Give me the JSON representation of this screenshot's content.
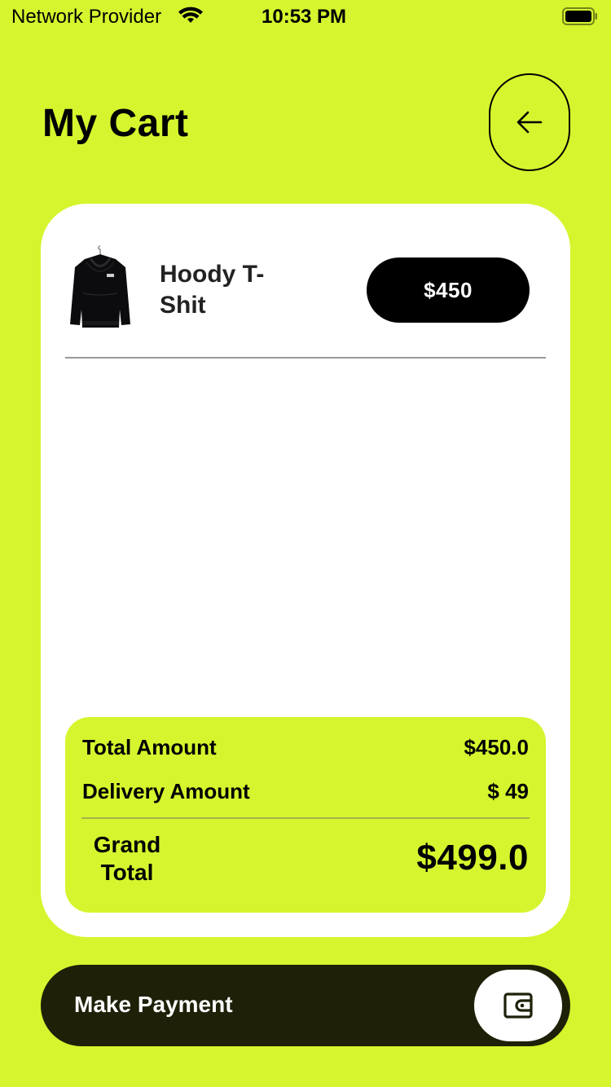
{
  "status_bar": {
    "carrier": "Network Provider",
    "time": "10:53 PM",
    "icons": [
      "wifi-icon",
      "battery-icon"
    ]
  },
  "header": {
    "title": "My Cart",
    "back_icon": "arrow-left-icon"
  },
  "cart": {
    "items": [
      {
        "name": "Hoody T-Shit",
        "price": "$450",
        "image": "black-hoodie"
      }
    ]
  },
  "summary": {
    "total_label": "Total Amount",
    "total_value": "$450.0",
    "delivery_label": "Delivery Amount",
    "delivery_value": "$ 49",
    "grand_label": "Grand Total",
    "grand_value": "$499.0"
  },
  "payment": {
    "label": "Make Payment",
    "icon": "wallet-icon"
  },
  "colors": {
    "background": "#d6f52e",
    "card": "#ffffff",
    "pill": "#000000",
    "payment_bar": "#1e2008"
  }
}
